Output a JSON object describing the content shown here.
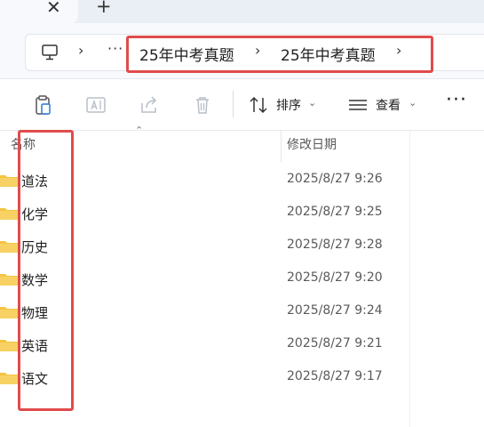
{
  "tabstrip": {
    "close_glyph": "✕",
    "new_tab_glyph": "+"
  },
  "address": {
    "icon": "computer-icon",
    "overflow": "···",
    "separator": "›",
    "crumbs": [
      "25年中考真题",
      "25年中考真题"
    ]
  },
  "toolbar": {
    "sort_label": "排序",
    "view_label": "查看",
    "caret": "⌄",
    "more": "···"
  },
  "columns": {
    "name": "名称",
    "modified": "修改日期",
    "sort_indicator": "⌃"
  },
  "files": [
    {
      "name": "道法",
      "modified": "2025/8/27 9:26"
    },
    {
      "name": "化学",
      "modified": "2025/8/27 9:25"
    },
    {
      "name": "历史",
      "modified": "2025/8/27 9:28"
    },
    {
      "name": "数学",
      "modified": "2025/8/27 9:20"
    },
    {
      "name": "物理",
      "modified": "2025/8/27 9:24"
    },
    {
      "name": "英语",
      "modified": "2025/8/27 9:21"
    },
    {
      "name": "语文",
      "modified": "2025/8/27 9:17"
    }
  ],
  "colors": {
    "accent": "#e04b4b",
    "folder": "#f4c542"
  }
}
